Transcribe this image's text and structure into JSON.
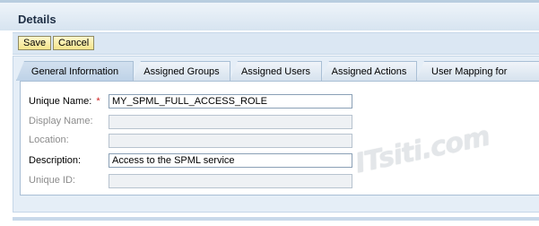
{
  "header": {
    "title": "Details"
  },
  "toolbar": {
    "save_label": "Save",
    "cancel_label": "Cancel"
  },
  "tabs": [
    {
      "label": "General Information",
      "active": true
    },
    {
      "label": "Assigned Groups",
      "active": false
    },
    {
      "label": "Assigned Users",
      "active": false
    },
    {
      "label": "Assigned Actions",
      "active": false
    },
    {
      "label": "User Mapping for System",
      "active": false
    }
  ],
  "form": {
    "unique_name": {
      "label": "Unique Name:",
      "required_mark": "*",
      "value": "MY_SPML_FULL_ACCESS_ROLE"
    },
    "display_name": {
      "label": "Display Name:",
      "value": ""
    },
    "location": {
      "label": "Location:",
      "value": ""
    },
    "description": {
      "label": "Description:",
      "value": "Access to the SPML service"
    },
    "unique_id": {
      "label": "Unique ID:",
      "value": ""
    }
  },
  "watermark": "ITsiti.com",
  "colors": {
    "accent": "#f4e48b",
    "required": "#d02020",
    "tab_border": "#a9bfd5"
  }
}
